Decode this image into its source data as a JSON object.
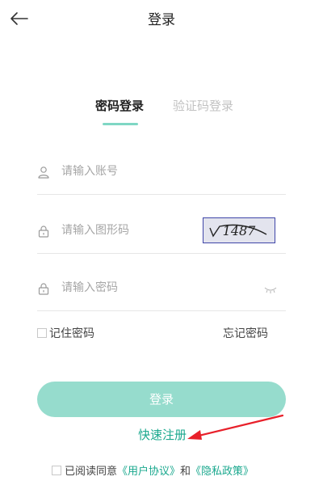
{
  "header": {
    "title": "登录"
  },
  "tabs": {
    "password": "密码登录",
    "sms": "验证码登录"
  },
  "form": {
    "account_placeholder": "请输入账号",
    "captcha_placeholder": "请输入图形码",
    "captcha_text": "1487",
    "password_placeholder": "请输入密码"
  },
  "options": {
    "remember": "记住密码",
    "forgot": "忘记密码"
  },
  "actions": {
    "login": "登录",
    "register": "快速注册"
  },
  "agreement": {
    "prefix": "已阅读同意",
    "user_agreement": "《用户协议》",
    "and": "和",
    "privacy": "《隐私政策》"
  },
  "colors": {
    "accent": "#1aa88e",
    "button": "#96dccd",
    "tab_indicator": "#7fd7c4",
    "annotation_arrow": "#e8202a"
  }
}
